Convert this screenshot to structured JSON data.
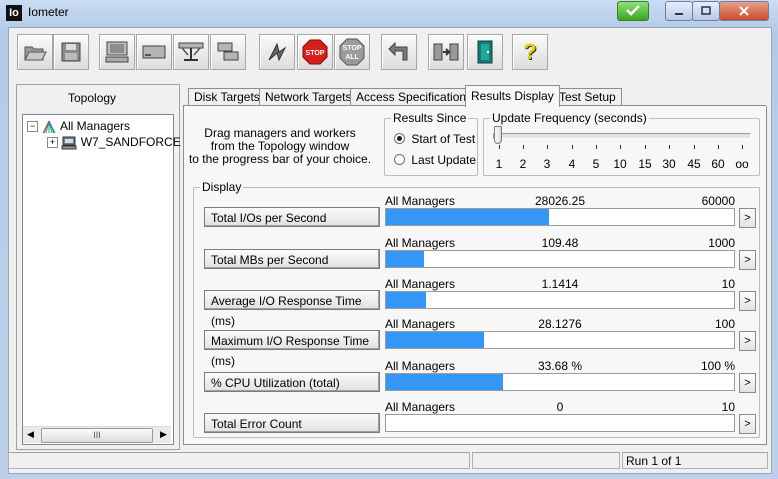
{
  "window": {
    "title": "Iometer",
    "icon_text": "Io"
  },
  "toolbar": {
    "buttons": [
      {
        "name": "open-icon"
      },
      {
        "name": "save-icon"
      },
      {
        "name": "new-worker-icon"
      },
      {
        "name": "new-disk-worker-icon"
      },
      {
        "name": "new-network-worker-icon"
      },
      {
        "name": "duplicate-worker-icon"
      },
      {
        "name": "start-tests-icon"
      },
      {
        "name": "stop-icon",
        "label": "STOP"
      },
      {
        "name": "stop-all-icon",
        "label": "STOP ALL"
      },
      {
        "name": "reset-workers-icon"
      },
      {
        "name": "exit-icon"
      },
      {
        "name": "about-icon",
        "label": "?"
      }
    ]
  },
  "topology": {
    "title": "Topology",
    "items": [
      {
        "label": "All Managers"
      },
      {
        "label": "W7_SANDFORCE"
      }
    ],
    "scroll_glyph": "III"
  },
  "tabs": [
    {
      "label": "Disk Targets"
    },
    {
      "label": "Network Targets"
    },
    {
      "label": "Access Specifications"
    },
    {
      "label": "Results Display",
      "active": true
    },
    {
      "label": "Test Setup"
    }
  ],
  "results": {
    "instructions": [
      "Drag managers and workers",
      "from the Topology window",
      "to the progress bar of your choice."
    ],
    "since": {
      "title": "Results Since",
      "options": [
        "Start of Test",
        "Last Update"
      ],
      "selected": "Start of Test"
    },
    "update": {
      "title": "Update Frequency (seconds)",
      "ticks": [
        "1",
        "2",
        "3",
        "4",
        "5",
        "10",
        "15",
        "30",
        "45",
        "60",
        "oo"
      ],
      "selected": "1"
    },
    "display_title": "Display",
    "metrics": [
      {
        "label": "Total I/Os per Second",
        "source": "All Managers",
        "value": "28026.25",
        "max": "60000",
        "fraction": 0.467
      },
      {
        "label": "Total MBs per Second",
        "source": "All Managers",
        "value": "109.48",
        "max": "1000",
        "fraction": 0.1095
      },
      {
        "label": "Average I/O Response Time (ms)",
        "source": "All Managers",
        "value": "1.1414",
        "max": "10",
        "fraction": 0.1141
      },
      {
        "label": "Maximum I/O Response Time (ms)",
        "source": "All Managers",
        "value": "28.1276",
        "max": "100",
        "fraction": 0.2813
      },
      {
        "label": "% CPU Utilization (total)",
        "source": "All Managers",
        "value": "33.68 %",
        "max": "100 %",
        "fraction": 0.3368
      },
      {
        "label": "Total Error Count",
        "source": "All Managers",
        "value": "0",
        "max": "10",
        "fraction": 0
      }
    ],
    "arrow_glyph": ">"
  },
  "status": {
    "run": "Run 1 of 1"
  },
  "colors": {
    "bar": "#3496f7"
  }
}
